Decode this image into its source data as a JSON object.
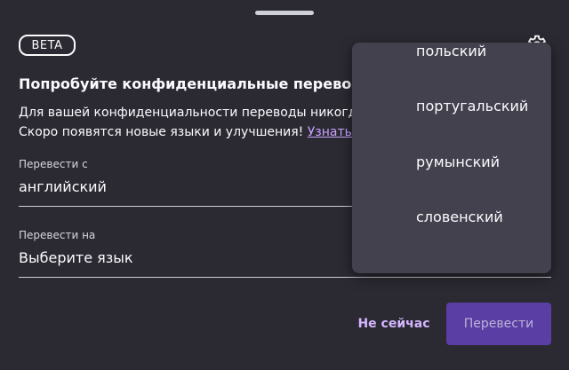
{
  "badge": "BETA",
  "title": "Попробуйте конфиденциальные переводы в Fi",
  "description": {
    "line1": "Для вашей конфиденциальности переводы никогда н",
    "line2": "Скоро появятся новые языки и улучшения!",
    "link": "Узнать бо"
  },
  "from": {
    "label": "Перевести с",
    "value": "английский"
  },
  "to": {
    "label": "Перевести на",
    "value": "Выберите язык"
  },
  "buttons": {
    "secondary": "Не сейчас",
    "primary": "Перевести"
  },
  "dropdown": {
    "items": [
      "польский",
      "португальский",
      "румынский",
      "словенский"
    ]
  },
  "colors": {
    "background": "#2b2a33",
    "link": "#c9a2ff",
    "primary_button": "#5a3ea3",
    "dropdown_background": "#42414d"
  },
  "icons": {
    "settings": "gear-icon"
  }
}
